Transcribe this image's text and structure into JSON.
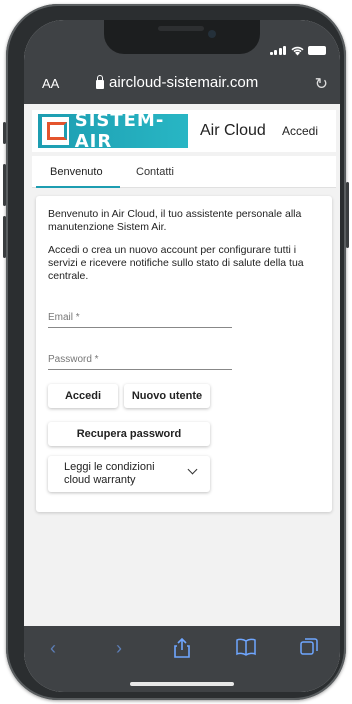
{
  "status_bar": {
    "signal": "signal-icon",
    "wifi": "wifi-icon",
    "battery": "battery-icon"
  },
  "browser": {
    "text_size_label": "AA",
    "url": "aircloud-sistemair.com",
    "reload_icon": "reload-icon"
  },
  "site": {
    "logo_text": "SISTEM-AIR",
    "title": "Air Cloud",
    "login_link": "Accedi"
  },
  "tabs": [
    {
      "label": "Benvenuto",
      "active": true
    },
    {
      "label": "Contatti",
      "active": false
    }
  ],
  "content": {
    "intro": "Benvenuto in Air Cloud, il tuo assistente personale alla manutenzione Sistem Air.",
    "description": "Accedi o crea un nuovo account per configurare tutti i servizi e ricevere notifiche sullo stato di salute della tua centrale.",
    "email_label": "Email *",
    "password_label": "Password *",
    "login_button": "Accedi",
    "new_user_button": "Nuovo utente",
    "recover_button": "Recupera password",
    "warranty_button": "Leggi le condizioni cloud warranty"
  },
  "toolbar": {
    "back": "back-icon",
    "forward": "forward-icon",
    "share": "share-icon",
    "bookmarks": "bookmarks-icon",
    "tabs": "tabs-icon"
  },
  "colors": {
    "accent": "#1d9db1",
    "browser_chrome": "#3f4245",
    "ios_link": "#6fa6ff"
  }
}
